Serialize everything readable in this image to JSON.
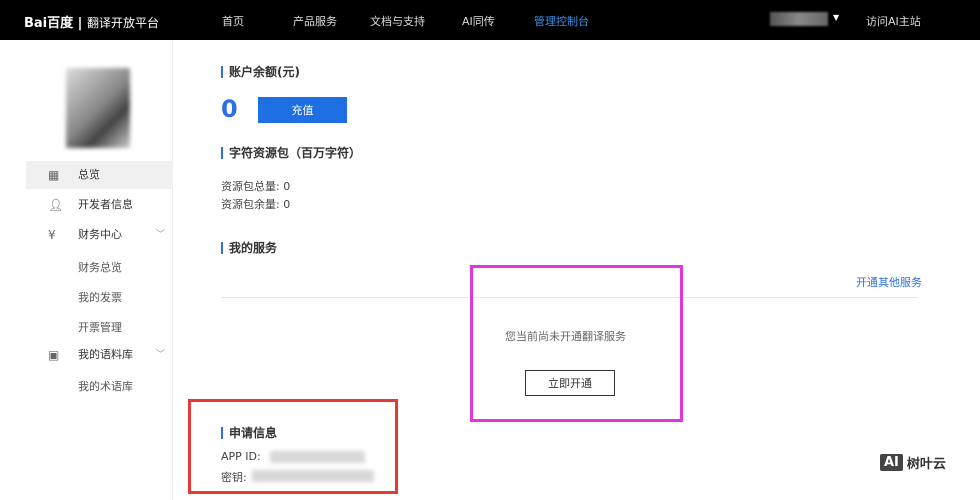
{
  "header": {
    "logo": "Bai百度",
    "product": "翻译开放平台",
    "nav": [
      "首页",
      "产品服务",
      "文档与支持",
      "AI同传",
      "管理控制台"
    ],
    "active_index": 4,
    "visit": "访问AI主站"
  },
  "sidebar": {
    "items": [
      {
        "label": "总览",
        "icon": "grid-icon"
      },
      {
        "label": "开发者信息",
        "icon": "user-icon"
      },
      {
        "label": "财务中心",
        "icon": "yen-icon"
      },
      {
        "label": "我的语料库",
        "icon": "box-icon"
      }
    ],
    "finance_sub": [
      "财务总览",
      "我的发票",
      "开票管理"
    ],
    "corpus_sub": [
      "我的术语库"
    ]
  },
  "balance": {
    "title": "账户余额(元)",
    "value": "0",
    "recharge": "充值"
  },
  "package": {
    "title": "字符资源包（百万字符）",
    "total": "资源包总量: 0",
    "remain": "资源包余量: 0"
  },
  "services": {
    "title": "我的服务",
    "open_other": "开通其他服务",
    "empty": "您当前尚未开通翻译服务",
    "open_now": "立即开通"
  },
  "apply": {
    "title": "申请信息",
    "app_id_label": "APP ID:",
    "secret_label": "密钥:"
  },
  "watermark": {
    "badge": "AI",
    "text": "树叶云"
  },
  "colors": {
    "accent": "#1d6fe3",
    "highlight_magenta": "#e135e0",
    "highlight_red": "#e53935"
  }
}
